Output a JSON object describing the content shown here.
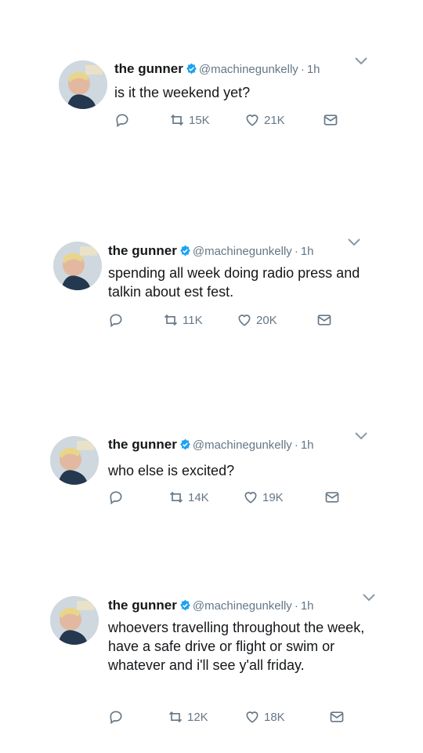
{
  "colors": {
    "text": "#14171a",
    "muted": "#657786",
    "verified": "#1da1f2"
  },
  "tweets": [
    {
      "name": "the gunner",
      "handle": "@machinegunkelly",
      "separator": "·",
      "time": "1h",
      "text": "is it the weekend yet?",
      "retweets": "15K",
      "likes": "21K"
    },
    {
      "name": "the gunner",
      "handle": "@machinegunkelly",
      "separator": "·",
      "time": "1h",
      "text": "spending all week doing radio press and talkin about est fest.",
      "retweets": "11K",
      "likes": "20K"
    },
    {
      "name": "the gunner",
      "handle": "@machinegunkelly",
      "separator": "·",
      "time": "1h",
      "text": "who else is excited?",
      "retweets": "14K",
      "likes": "19K"
    },
    {
      "name": "the gunner",
      "handle": "@machinegunkelly",
      "separator": "·",
      "time": "1h",
      "text": "whoevers travelling throughout the week, have a safe drive or flight or swim or whatever and i'll see y'all friday.",
      "retweets": "12K",
      "likes": "18K"
    }
  ],
  "icons": [
    "avatar",
    "verified-badge-icon",
    "chevron-down-icon",
    "reply-icon",
    "retweet-icon",
    "like-icon",
    "message-icon"
  ]
}
